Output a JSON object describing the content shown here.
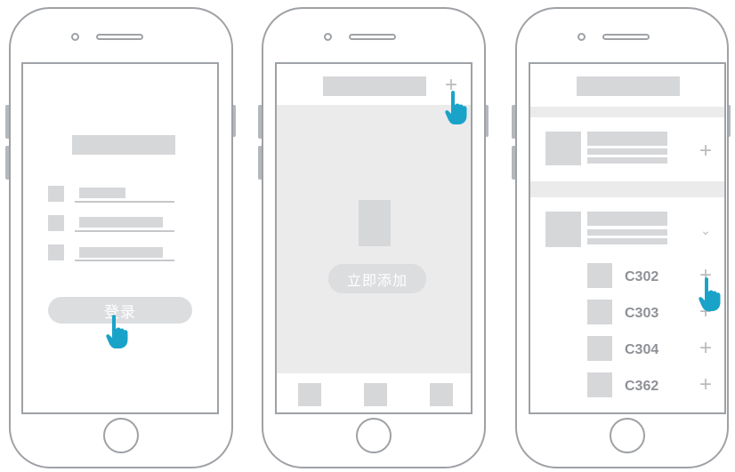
{
  "phone1": {
    "login_button": "登录"
  },
  "phone2": {
    "add_now_button": "立即添加"
  },
  "phone3": {
    "sub_items": [
      {
        "code": "C302"
      },
      {
        "code": "C303"
      },
      {
        "code": "C304"
      },
      {
        "code": "C362"
      }
    ],
    "plus_icon": "+",
    "chevron_icon": "⌄"
  },
  "colors": {
    "frame": "#9ea1a5",
    "placeholder": "#d6d7d9",
    "hand": "#1aa3c8",
    "pill": "#dcdddf"
  }
}
